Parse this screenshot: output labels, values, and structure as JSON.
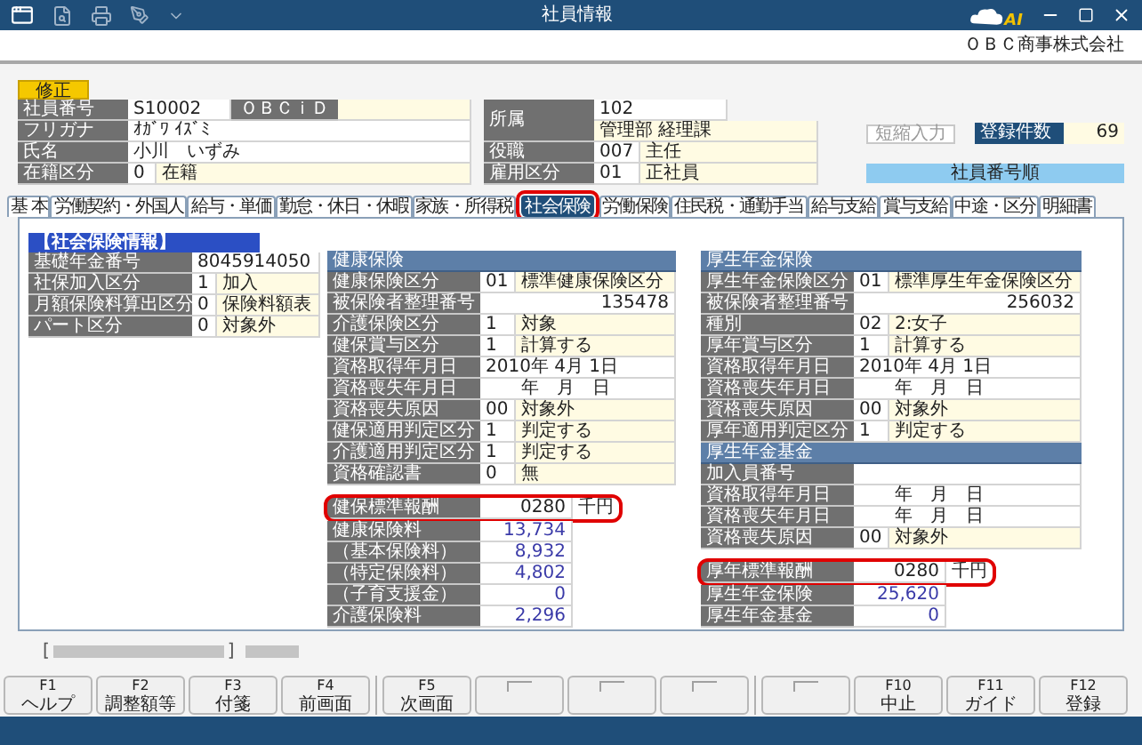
{
  "window": {
    "title": "社員情報",
    "logo_text": "AI"
  },
  "company": "ＯＢＣ商事株式会社",
  "mode": "修正",
  "employee": {
    "number_label": "社員番号",
    "number": "S10002",
    "obcid_label": "ＯＢＣｉＤ",
    "kana_label": "フリガナ",
    "kana": "ｵｶﾞﾜ ｲｽﾞﾐ",
    "name_label": "氏名",
    "name": "小川　いずみ",
    "status_label": "在籍区分",
    "status_code": "0",
    "status": "在籍"
  },
  "assignment": {
    "dept_label": "所属",
    "dept_code": "102",
    "dept": "管理部 経理課",
    "post_label": "役職",
    "post_code": "007",
    "post": "主任",
    "type_label": "雇用区分",
    "type_code": "01",
    "type": "正社員"
  },
  "shortcut_button": "短縮入力",
  "count_label": "登録件数",
  "count": "69",
  "sort_label": "社員番号順",
  "tabs": [
    {
      "label": "基 本",
      "selected": false,
      "highlighted": false
    },
    {
      "label": "労働契約・外国人",
      "selected": false,
      "highlighted": false
    },
    {
      "label": "給与・単価",
      "selected": false,
      "highlighted": false
    },
    {
      "label": "勤怠・休日・休暇",
      "selected": false,
      "highlighted": false
    },
    {
      "label": "家族・所得税",
      "selected": false,
      "highlighted": false
    },
    {
      "label": "社会保険",
      "selected": true,
      "highlighted": true
    },
    {
      "label": "労働保険",
      "selected": false,
      "highlighted": false
    },
    {
      "label": "住民税・通勤手当",
      "selected": false,
      "highlighted": false
    },
    {
      "label": "給与支給",
      "selected": false,
      "highlighted": false
    },
    {
      "label": "賞与支給",
      "selected": false,
      "highlighted": false
    },
    {
      "label": "中途・区分",
      "selected": false,
      "highlighted": false
    },
    {
      "label": "明細書",
      "selected": false,
      "highlighted": false
    }
  ],
  "social_insurance": {
    "title": "【社会保険情報】",
    "rows": [
      {
        "kind": "value",
        "label": "基礎年金番号",
        "value": "8045914050"
      },
      {
        "kind": "code",
        "label": "社保加入区分",
        "code": "1",
        "value": "加入"
      },
      {
        "kind": "code",
        "label": "月額保険料算出区分",
        "code": "0",
        "value": "保険料額表"
      },
      {
        "kind": "code",
        "label": "パート区分",
        "code": "0",
        "value": "対象外"
      }
    ]
  },
  "health_insurance": {
    "rows": [
      {
        "kind": "header",
        "label": "健康保険"
      },
      {
        "kind": "code",
        "label": "健康保険区分",
        "code": "01",
        "value": "標準健康保険区分"
      },
      {
        "kind": "number",
        "label": "被保険者整理番号",
        "value": "135478"
      },
      {
        "kind": "code",
        "label": "介護保険区分",
        "code": "1",
        "value": "対象"
      },
      {
        "kind": "code",
        "label": "健保賞与区分",
        "code": "1",
        "value": "計算する"
      },
      {
        "kind": "value",
        "label": "資格取得年月日",
        "value": "2010年 4月 1日"
      },
      {
        "kind": "value",
        "label": "資格喪失年月日",
        "value": "　　年　月　日"
      },
      {
        "kind": "code",
        "label": "資格喪失原因",
        "code": "00",
        "value": "対象外"
      },
      {
        "kind": "code",
        "label": "健保適用判定区分",
        "code": "1",
        "value": "判定する"
      },
      {
        "kind": "code",
        "label": "介護適用判定区分",
        "code": "1",
        "value": "判定する"
      },
      {
        "kind": "code",
        "label": "資格確認書",
        "code": "0",
        "value": "無"
      },
      {
        "kind": "salary",
        "label": "健保標準報酬",
        "value": "0280",
        "unit": "千円",
        "highlighted": true
      },
      {
        "kind": "amount",
        "label": "健康保険料",
        "value": "13,734"
      },
      {
        "kind": "amount",
        "label": "（基本保険料）",
        "value": "8,932"
      },
      {
        "kind": "amount",
        "label": "（特定保険料）",
        "value": "4,802"
      },
      {
        "kind": "amount",
        "label": "（子育支援金）",
        "value": "0"
      },
      {
        "kind": "amount",
        "label": "介護保険料",
        "value": "2,296"
      }
    ]
  },
  "pension": {
    "rows": [
      {
        "kind": "header",
        "label": "厚生年金保険"
      },
      {
        "kind": "code",
        "label": "厚生年金保険区分",
        "code": "01",
        "value": "標準厚生年金保険区分"
      },
      {
        "kind": "number",
        "label": "被保険者整理番号",
        "value": "256032"
      },
      {
        "kind": "code",
        "label": "種別",
        "code": "02",
        "value": "2:女子"
      },
      {
        "kind": "code",
        "label": "厚年賞与区分",
        "code": "1",
        "value": "計算する"
      },
      {
        "kind": "value",
        "label": "資格取得年月日",
        "value": "2010年 4月 1日"
      },
      {
        "kind": "value",
        "label": "資格喪失年月日",
        "value": "　　年　月　日"
      },
      {
        "kind": "code",
        "label": "資格喪失原因",
        "code": "00",
        "value": "対象外"
      },
      {
        "kind": "code",
        "label": "厚年適用判定区分",
        "code": "1",
        "value": "判定する"
      },
      {
        "kind": "header",
        "label": "厚生年金基金"
      },
      {
        "kind": "value",
        "label": "加入員番号"
      },
      {
        "kind": "value",
        "label": "資格取得年月日",
        "value": "　　年　月　日"
      },
      {
        "kind": "value",
        "label": "資格喪失年月日",
        "value": "　　年　月　日"
      },
      {
        "kind": "code",
        "label": "資格喪失原因",
        "code": "00",
        "value": "対象外"
      },
      {
        "kind": "salary",
        "label": "厚年標準報酬",
        "value": "0280",
        "unit": "千円",
        "highlighted": true
      },
      {
        "kind": "amount",
        "label": "厚生年金保険",
        "value": "25,620"
      },
      {
        "kind": "amount",
        "label": "厚生年金基金",
        "value": "0"
      }
    ]
  },
  "status_line": {
    "open": "[",
    "close": "]"
  },
  "function_key_groups": [
    [
      {
        "kind": "key",
        "key": "F1",
        "label": "ヘルプ"
      },
      {
        "kind": "key",
        "key": "F2",
        "label": "調整額等"
      },
      {
        "kind": "key",
        "key": "F3",
        "label": "付箋"
      },
      {
        "kind": "key",
        "key": "F4",
        "label": "前画面"
      }
    ],
    [
      {
        "kind": "key",
        "key": "F5",
        "label": "次画面"
      },
      {
        "kind": "blank"
      },
      {
        "kind": "blank"
      },
      {
        "kind": "blank"
      }
    ],
    [
      {
        "kind": "blank"
      },
      {
        "kind": "key",
        "key": "F10",
        "label": "中止"
      },
      {
        "kind": "key",
        "key": "F11",
        "label": "ガイド"
      },
      {
        "kind": "key",
        "key": "F12",
        "label": "登録"
      }
    ]
  ]
}
